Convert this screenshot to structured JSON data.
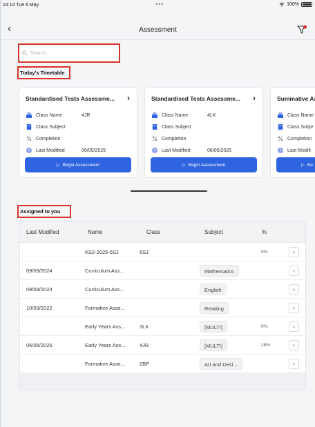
{
  "status_bar": {
    "time": "14:14  Tue 6 May",
    "dots": "•••",
    "battery": "100%"
  },
  "nav": {
    "back_icon": "‹",
    "title": "Assessment",
    "filter_icon": "filter-icon"
  },
  "search": {
    "placeholder": "Search..."
  },
  "timetable": {
    "label": "Today's Timetable",
    "field_labels": {
      "class_name": "Class Name",
      "class_subject": "Class Subject",
      "completion": "Completion",
      "last_modified": "Last Modified"
    },
    "begin_label": "Begin Assessment",
    "cards": [
      {
        "title": "Standardised Tests Assessme...",
        "class_name": "4JR",
        "last_modified": "06/05/2025"
      },
      {
        "title": "Standardised Tests Assessme...",
        "class_name": "4LK",
        "last_modified": "06/05/2025"
      },
      {
        "title": "Summative As",
        "class_name": "",
        "last_modified": ""
      }
    ],
    "third_card_labels": {
      "class_name": "Class Name",
      "class_subject": "Class Subje",
      "completion": "Completion",
      "last_modified": "Last Modifi",
      "begin": "Be"
    }
  },
  "assigned": {
    "label": "Assigned to you",
    "headers": {
      "last_modified": "Last Modified",
      "name": "Name",
      "class": "Class",
      "subject": "Subject",
      "pct": "%"
    },
    "rows": [
      {
        "last_modified": "",
        "name": "KS2-2025-6SJ",
        "class": "6SJ",
        "subject": "",
        "pct": "0%"
      },
      {
        "last_modified": "09/09/2024",
        "name": "Curriculum Ass...",
        "class": "",
        "subject": "Mathematics",
        "pct": ""
      },
      {
        "last_modified": "09/09/2024",
        "name": "Curriculum Ass...",
        "class": "",
        "subject": "English",
        "pct": ""
      },
      {
        "last_modified": "10/03/2022",
        "name": "Formative Asse...",
        "class": "",
        "subject": "Reading",
        "pct": ""
      },
      {
        "last_modified": "",
        "name": "Early Years Ass...",
        "class": "3LK",
        "subject": "[MULTI]",
        "pct": "0%"
      },
      {
        "last_modified": "06/05/2025",
        "name": "Early Years Ass...",
        "class": "4JR",
        "subject": "[MULTI]",
        "pct": "28%"
      },
      {
        "last_modified": "",
        "name": "Formative Asse...",
        "class": "2BP",
        "subject": "Art and Desi...",
        "pct": ""
      }
    ],
    "row_arrow": "›"
  },
  "colors": {
    "accent": "#2f64e0",
    "highlight": "#d9322a"
  }
}
